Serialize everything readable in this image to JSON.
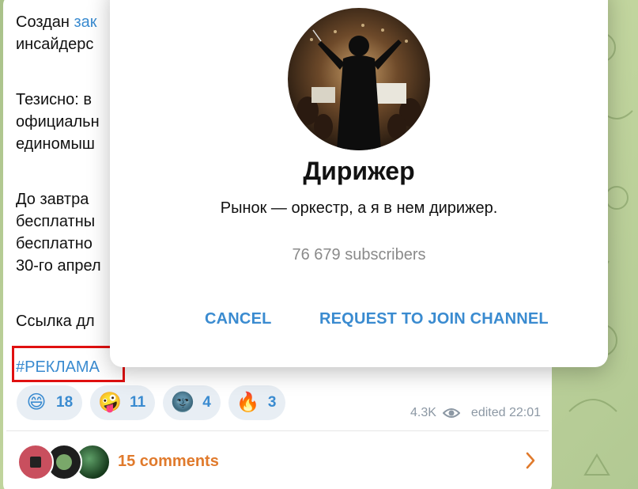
{
  "message": {
    "lines": [
      {
        "prefix": "Создан ",
        "link": "зак"
      },
      {
        "text": "инсайдерс"
      },
      {
        "text": ""
      },
      {
        "text": "Тезисно: в"
      },
      {
        "text": "официальн"
      },
      {
        "text": "единомыш"
      },
      {
        "text": ""
      },
      {
        "text": "До завтра"
      },
      {
        "text": "бесплатны"
      },
      {
        "text": "бесплатно"
      },
      {
        "text": "30-го апрел"
      },
      {
        "text": ""
      },
      {
        "text": "Ссылка дл"
      }
    ],
    "hashtag": "#РЕКЛАМА",
    "reactions": [
      {
        "emoji": "😄",
        "count": "18"
      },
      {
        "emoji": "🤪",
        "count": "11"
      },
      {
        "emoji": "🌚",
        "count": "4"
      },
      {
        "emoji": "🔥",
        "count": "3"
      }
    ],
    "views": "4.3K",
    "edited": "edited 22:01",
    "comments_label": "15 comments"
  },
  "dialog": {
    "title": "Дирижер",
    "description": "Рынок — оркестр, а я в нем дирижер.",
    "subscribers": "76 679 subscribers",
    "cancel_label": "CANCEL",
    "join_label": "REQUEST TO JOIN CHANNEL"
  },
  "colors": {
    "accent": "#3a8bd0",
    "comments": "#e07a2c",
    "highlight_box": "#e01010",
    "reaction_bg": "#e8eef4"
  }
}
